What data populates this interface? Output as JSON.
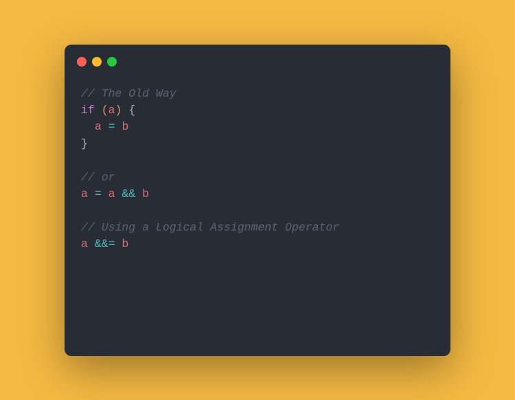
{
  "code": {
    "c1": "// The Old Way",
    "kw_if": "if",
    "lp": "(",
    "a1": "a",
    "rp": ")",
    "lb": " {",
    "indent": "  ",
    "a2": "a",
    "eq1": " = ",
    "b1": "b",
    "rb": "}",
    "c2": "// or",
    "a3": "a",
    "eq2": " = ",
    "a4": "a",
    "and1": " && ",
    "b2": "b",
    "c3": "// Using a Logical Assignment Operator",
    "a5": "a",
    "andeq": " &&= ",
    "b3": "b"
  }
}
